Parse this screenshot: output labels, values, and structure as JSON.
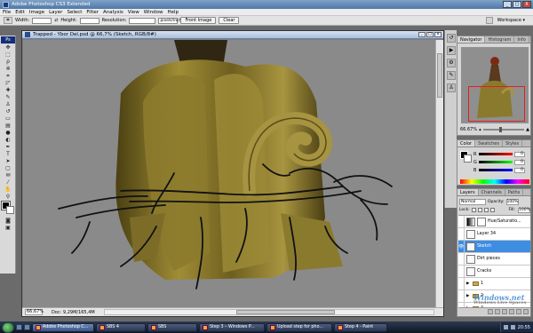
{
  "app": {
    "title": "Adobe Photoshop CS3 Extended",
    "window_controls": [
      "_",
      "□",
      "X"
    ]
  },
  "menu": [
    "File",
    "Edit",
    "Image",
    "Layer",
    "Select",
    "Filter",
    "Analysis",
    "View",
    "Window",
    "Help"
  ],
  "options_bar": {
    "width_label": "Width:",
    "height_label": "Height:",
    "resolution_label": "Resolution:",
    "resolution_unit": "pixels/inch",
    "front_image_button": "Front Image",
    "clear_button": "Clear",
    "workspace_label": "Workspace ▾"
  },
  "document": {
    "title": "Trapped - Ybor Del.psd @ 66,7% (Sketch, RGB/8#)",
    "zoom": "66,67%",
    "doc_info": "Doc: 9,29M/165,4M"
  },
  "panels": {
    "navigator_tabs": [
      "Navigator",
      "Histogram",
      "Info"
    ],
    "navigator_zoom": "66.67%",
    "color_tabs": [
      "Color",
      "Swatches",
      "Styles"
    ],
    "color_channels": [
      {
        "label": "R",
        "value": "0"
      },
      {
        "label": "G",
        "value": "0"
      },
      {
        "label": "B",
        "value": "0"
      }
    ],
    "layers_tabs": [
      "Layers",
      "Channels",
      "Paths"
    ],
    "blend_mode": "Normal",
    "opacity_label": "Opacity:",
    "opacity": "100%",
    "lock_label": "Lock:",
    "fill_label": "Fill:",
    "fill": "100%",
    "layers": [
      {
        "name": "Hue/Saturatio...",
        "kind": "adjust"
      },
      {
        "name": "Layer 34",
        "kind": "layer"
      },
      {
        "name": "Sketch",
        "kind": "layer",
        "selected": true
      },
      {
        "name": "Dirt pieces",
        "kind": "layer"
      },
      {
        "name": "Cracks",
        "kind": "layer"
      },
      {
        "name": "1",
        "kind": "group"
      },
      {
        "name": "2",
        "kind": "group"
      },
      {
        "name": "4",
        "kind": "group"
      }
    ]
  },
  "taskbar": {
    "items": [
      {
        "label": "Adobe Photoshop C...",
        "active": true
      },
      {
        "label": "SBS 4"
      },
      {
        "label": "SBS"
      },
      {
        "label": "Step 3 – Windows P..."
      },
      {
        "label": "Upload step for pho..."
      },
      {
        "label": "Step 4 - Paint"
      }
    ],
    "clock": "20:55"
  },
  "watermark": {
    "text": "Windows.net",
    "sub": "Windows Live Spaces"
  },
  "colors": {
    "accent": "#3d8de3",
    "sketch_ink": "#111111",
    "trunk": "#8a7a2a"
  }
}
